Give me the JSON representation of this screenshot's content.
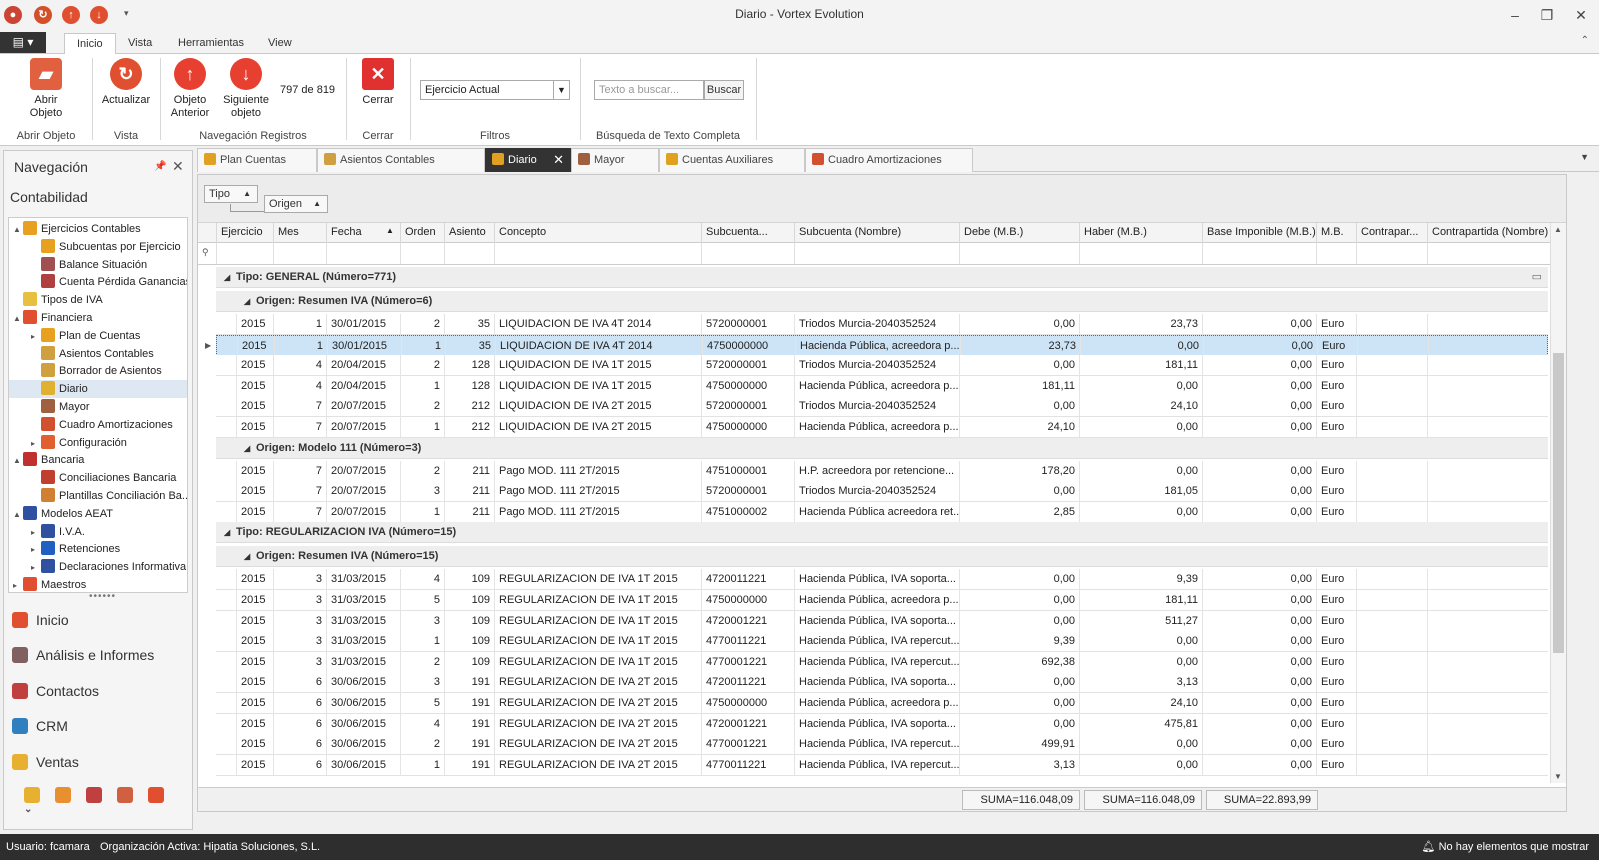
{
  "app": {
    "title": "Diario - Vortex Evolution"
  },
  "ribbon_tabs": [
    "Inicio",
    "Vista",
    "Herramientas",
    "View"
  ],
  "ribbon": {
    "abrir_objeto": "Abrir\nObjeto",
    "actualizar": "Actualizar",
    "objeto_anterior": "Objeto\nAnterior",
    "siguiente_objeto": "Siguiente\nobjeto",
    "record_count": "797 de 819",
    "cerrar": "Cerrar",
    "filtro_value": "Ejercicio Actual",
    "search_placeholder": "Texto a buscar...",
    "search_button": "Buscar",
    "groups": {
      "abrir_objeto": "Abrir Objeto",
      "vista": "Vista",
      "navegacion": "Navegación Registros",
      "cerrar": "Cerrar",
      "filtros": "Filtros",
      "busqueda": "Búsqueda de Texto Completa"
    }
  },
  "nav": {
    "title": "Navegación",
    "section": "Contabilidad",
    "tree": [
      {
        "label": "Ejercicios Contables",
        "level": 0,
        "exp": "▲",
        "color": "#e8a020"
      },
      {
        "label": "Subcuentas por Ejercicio",
        "level": 1,
        "exp": "",
        "color": "#e8a020"
      },
      {
        "label": "Balance Situación",
        "level": 1,
        "exp": "",
        "color": "#a05050"
      },
      {
        "label": "Cuenta Pérdida Ganancias",
        "level": 1,
        "exp": "",
        "color": "#b04040"
      },
      {
        "label": "Tipos de IVA",
        "level": 0,
        "exp": "",
        "color": "#e8c040"
      },
      {
        "label": "Financiera",
        "level": 0,
        "exp": "▲",
        "color": "#e05030"
      },
      {
        "label": "Plan de Cuentas",
        "level": 1,
        "exp": "▸",
        "color": "#e8a020"
      },
      {
        "label": "Asientos Contables",
        "level": 1,
        "exp": "",
        "color": "#d0a040"
      },
      {
        "label": "Borrador de Asientos",
        "level": 1,
        "exp": "",
        "color": "#d0a040"
      },
      {
        "label": "Diario",
        "level": 1,
        "exp": "",
        "color": "#e0b030",
        "selected": true
      },
      {
        "label": "Mayor",
        "level": 1,
        "exp": "",
        "color": "#a06040"
      },
      {
        "label": "Cuadro Amortizaciones",
        "level": 1,
        "exp": "",
        "color": "#d05030"
      },
      {
        "label": "Configuración",
        "level": 1,
        "exp": "▸",
        "color": "#e06030"
      },
      {
        "label": "Bancaria",
        "level": 0,
        "exp": "▲",
        "color": "#c03030"
      },
      {
        "label": "Conciliaciones Bancaria",
        "level": 1,
        "exp": "",
        "color": "#c04030"
      },
      {
        "label": "Plantillas Conciliación Ba...",
        "level": 1,
        "exp": "",
        "color": "#d08030"
      },
      {
        "label": "Modelos AEAT",
        "level": 0,
        "exp": "▲",
        "color": "#3050a0"
      },
      {
        "label": "I.V.A.",
        "level": 1,
        "exp": "▸",
        "color": "#3050a0"
      },
      {
        "label": "Retenciones",
        "level": 1,
        "exp": "▸",
        "color": "#2060c0"
      },
      {
        "label": "Declaraciones Informativa",
        "level": 1,
        "exp": "▸",
        "color": "#3050a0"
      },
      {
        "label": "Maestros",
        "level": 0,
        "exp": "▸",
        "color": "#e05030"
      }
    ],
    "groups": [
      {
        "label": "Inicio",
        "color": "#e05030"
      },
      {
        "label": "Análisis e Informes",
        "color": "#806060"
      },
      {
        "label": "Contactos",
        "color": "#c04040"
      },
      {
        "label": "CRM",
        "color": "#3080c0"
      },
      {
        "label": "Ventas",
        "color": "#e8b030"
      }
    ]
  },
  "doc_tabs": [
    "Plan Cuentas",
    "Asientos Contables",
    "Diario",
    "Mayor",
    "Cuentas Auxiliares",
    "Cuadro Amortizaciones"
  ],
  "group_chips": {
    "tipo": "Tipo",
    "origen": "Origen"
  },
  "columns": [
    "Ejercicio",
    "Mes",
    "Fecha",
    "Orden",
    "Asiento",
    "Concepto",
    "Subcuenta...",
    "Subcuenta (Nombre)",
    "Debe (M.B.)",
    "Haber (M.B.)",
    "Base Imponible (M.B.)",
    "M.B.",
    "Contrapar...",
    "Contrapartida (Nombre)"
  ],
  "rows": [
    {
      "kind": "g0",
      "text": "Tipo: GENERAL (Número=771)"
    },
    {
      "kind": "g1",
      "text": "Origen: Resumen IVA (Número=6)"
    },
    {
      "kind": "d",
      "v": [
        "2015",
        "1",
        "30/01/2015",
        "2",
        "35",
        "LIQUIDACION DE IVA 4T 2014",
        "5720000001",
        "Triodos Murcia-2040352524",
        "0,00",
        "23,73",
        "0,00",
        "Euro",
        "",
        ""
      ]
    },
    {
      "kind": "d",
      "sel": true,
      "v": [
        "2015",
        "1",
        "30/01/2015",
        "1",
        "35",
        "LIQUIDACION DE IVA 4T 2014",
        "4750000000",
        "Hacienda Pública, acreedora p...",
        "23,73",
        "0,00",
        "0,00",
        "Euro",
        "",
        ""
      ]
    },
    {
      "kind": "d",
      "v": [
        "2015",
        "4",
        "20/04/2015",
        "2",
        "128",
        "LIQUIDACION DE IVA 1T 2015",
        "5720000001",
        "Triodos Murcia-2040352524",
        "0,00",
        "181,11",
        "0,00",
        "Euro",
        "",
        ""
      ]
    },
    {
      "kind": "d",
      "v": [
        "2015",
        "4",
        "20/04/2015",
        "1",
        "128",
        "LIQUIDACION DE IVA 1T 2015",
        "4750000000",
        "Hacienda Pública, acreedora p...",
        "181,11",
        "0,00",
        "0,00",
        "Euro",
        "",
        ""
      ]
    },
    {
      "kind": "d",
      "v": [
        "2015",
        "7",
        "20/07/2015",
        "2",
        "212",
        "LIQUIDACION DE IVA 2T 2015",
        "5720000001",
        "Triodos Murcia-2040352524",
        "0,00",
        "24,10",
        "0,00",
        "Euro",
        "",
        ""
      ]
    },
    {
      "kind": "d",
      "v": [
        "2015",
        "7",
        "20/07/2015",
        "1",
        "212",
        "LIQUIDACION DE IVA 2T 2015",
        "4750000000",
        "Hacienda Pública, acreedora p...",
        "24,10",
        "0,00",
        "0,00",
        "Euro",
        "",
        ""
      ]
    },
    {
      "kind": "g1",
      "text": "Origen: Modelo 111 (Número=3)"
    },
    {
      "kind": "d",
      "v": [
        "2015",
        "7",
        "20/07/2015",
        "2",
        "211",
        "Pago MOD. 111 2T/2015",
        "4751000001",
        "H.P. acreedora por retencione...",
        "178,20",
        "0,00",
        "0,00",
        "Euro",
        "",
        ""
      ]
    },
    {
      "kind": "d",
      "v": [
        "2015",
        "7",
        "20/07/2015",
        "3",
        "211",
        "Pago MOD. 111 2T/2015",
        "5720000001",
        "Triodos Murcia-2040352524",
        "0,00",
        "181,05",
        "0,00",
        "Euro",
        "",
        ""
      ]
    },
    {
      "kind": "d",
      "v": [
        "2015",
        "7",
        "20/07/2015",
        "1",
        "211",
        "Pago MOD. 111 2T/2015",
        "4751000002",
        "Hacienda Pública acreedora ret...",
        "2,85",
        "0,00",
        "0,00",
        "Euro",
        "",
        ""
      ]
    },
    {
      "kind": "g0",
      "text": "Tipo: REGULARIZACION IVA (Número=15)"
    },
    {
      "kind": "g1",
      "text": "Origen: Resumen IVA (Número=15)"
    },
    {
      "kind": "d",
      "v": [
        "2015",
        "3",
        "31/03/2015",
        "4",
        "109",
        "REGULARIZACION DE IVA 1T 2015",
        "4720011221",
        "Hacienda Pública, IVA soporta...",
        "0,00",
        "9,39",
        "0,00",
        "Euro",
        "",
        ""
      ]
    },
    {
      "kind": "d",
      "v": [
        "2015",
        "3",
        "31/03/2015",
        "5",
        "109",
        "REGULARIZACION DE IVA 1T 2015",
        "4750000000",
        "Hacienda Pública, acreedora p...",
        "0,00",
        "181,11",
        "0,00",
        "Euro",
        "",
        ""
      ]
    },
    {
      "kind": "d",
      "v": [
        "2015",
        "3",
        "31/03/2015",
        "3",
        "109",
        "REGULARIZACION DE IVA 1T 2015",
        "4720001221",
        "Hacienda Pública, IVA soporta...",
        "0,00",
        "511,27",
        "0,00",
        "Euro",
        "",
        ""
      ]
    },
    {
      "kind": "d",
      "v": [
        "2015",
        "3",
        "31/03/2015",
        "1",
        "109",
        "REGULARIZACION DE IVA 1T 2015",
        "4770011221",
        "Hacienda Pública, IVA repercut...",
        "9,39",
        "0,00",
        "0,00",
        "Euro",
        "",
        ""
      ]
    },
    {
      "kind": "d",
      "v": [
        "2015",
        "3",
        "31/03/2015",
        "2",
        "109",
        "REGULARIZACION DE IVA 1T 2015",
        "4770001221",
        "Hacienda Pública, IVA repercut...",
        "692,38",
        "0,00",
        "0,00",
        "Euro",
        "",
        ""
      ]
    },
    {
      "kind": "d",
      "v": [
        "2015",
        "6",
        "30/06/2015",
        "3",
        "191",
        "REGULARIZACION DE IVA 2T 2015",
        "4720011221",
        "Hacienda Pública, IVA soporta...",
        "0,00",
        "3,13",
        "0,00",
        "Euro",
        "",
        ""
      ]
    },
    {
      "kind": "d",
      "v": [
        "2015",
        "6",
        "30/06/2015",
        "5",
        "191",
        "REGULARIZACION DE IVA 2T 2015",
        "4750000000",
        "Hacienda Pública, acreedora p...",
        "0,00",
        "24,10",
        "0,00",
        "Euro",
        "",
        ""
      ]
    },
    {
      "kind": "d",
      "v": [
        "2015",
        "6",
        "30/06/2015",
        "4",
        "191",
        "REGULARIZACION DE IVA 2T 2015",
        "4720001221",
        "Hacienda Pública, IVA soporta...",
        "0,00",
        "475,81",
        "0,00",
        "Euro",
        "",
        ""
      ]
    },
    {
      "kind": "d",
      "v": [
        "2015",
        "6",
        "30/06/2015",
        "2",
        "191",
        "REGULARIZACION DE IVA 2T 2015",
        "4770001221",
        "Hacienda Pública, IVA repercut...",
        "499,91",
        "0,00",
        "0,00",
        "Euro",
        "",
        ""
      ]
    },
    {
      "kind": "d",
      "v": [
        "2015",
        "6",
        "30/06/2015",
        "1",
        "191",
        "REGULARIZACION DE IVA 2T 2015",
        "4770011221",
        "Hacienda Pública, IVA repercut...",
        "3,13",
        "0,00",
        "0,00",
        "Euro",
        "",
        ""
      ]
    }
  ],
  "footer": {
    "sum_debe": "SUMA=116.048,09",
    "sum_haber": "SUMA=116.048,09",
    "sum_base": "SUMA=22.893,99"
  },
  "status": {
    "user": "Usuario: fcamara",
    "org": "Organización Activa: Hipatia Soluciones, S.L.",
    "notifications": "No hay elementos que mostrar"
  }
}
